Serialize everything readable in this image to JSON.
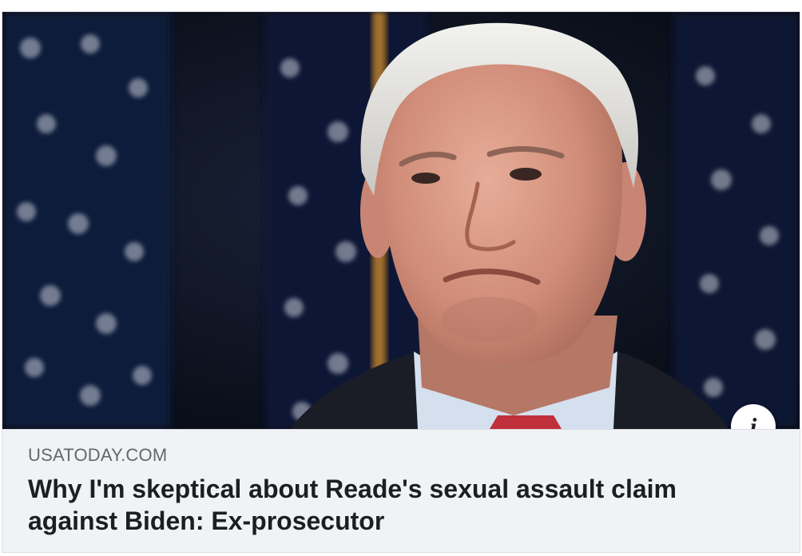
{
  "link_preview": {
    "domain": "USATODAY.COM",
    "headline": "Why I'm skeptical about Reade's sexual assault claim against Biden: Ex-prosecutor",
    "info_glyph": "i",
    "info_icon": "info-icon",
    "image_subject": "photo-of-man-in-front-of-flags"
  }
}
